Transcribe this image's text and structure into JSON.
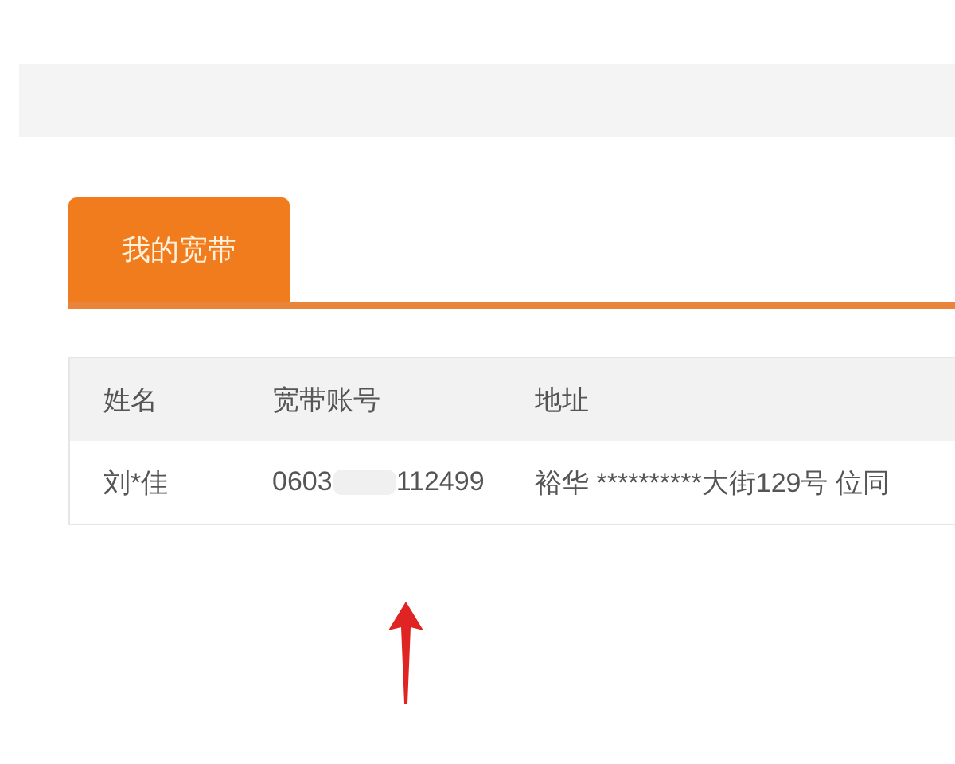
{
  "tabs": [
    {
      "label": "我的宽带",
      "selected": true
    }
  ],
  "table": {
    "columns": [
      "姓名",
      "宽带账号",
      "地址"
    ],
    "rows": [
      {
        "name": "刘*佳",
        "account_visible": [
          "0603",
          "112499"
        ],
        "address": "裕华 **********大街129号 位同"
      }
    ]
  }
}
